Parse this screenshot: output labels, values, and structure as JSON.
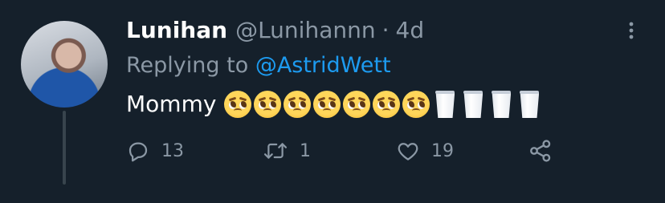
{
  "tweet": {
    "display_name": "Lunihan",
    "handle": "@Lunihannn",
    "separator": "·",
    "time": "4d",
    "replying_prefix": "Replying to",
    "replying_to": "@AstridWett",
    "text": "Mommy",
    "emoji": [
      "pleading-face",
      "pleading-face",
      "pleading-face",
      "pleading-face",
      "pleading-face",
      "pleading-face",
      "pleading-face",
      "glass-of-milk",
      "glass-of-milk",
      "glass-of-milk",
      "glass-of-milk"
    ]
  },
  "actions": {
    "reply_count": "13",
    "retweet_count": "1",
    "like_count": "19"
  },
  "colors": {
    "background": "#15202b",
    "primary_text": "#ffffff",
    "secondary_text": "#8b98a5",
    "accent": "#1d9bf0",
    "thread_line": "#38444d"
  }
}
